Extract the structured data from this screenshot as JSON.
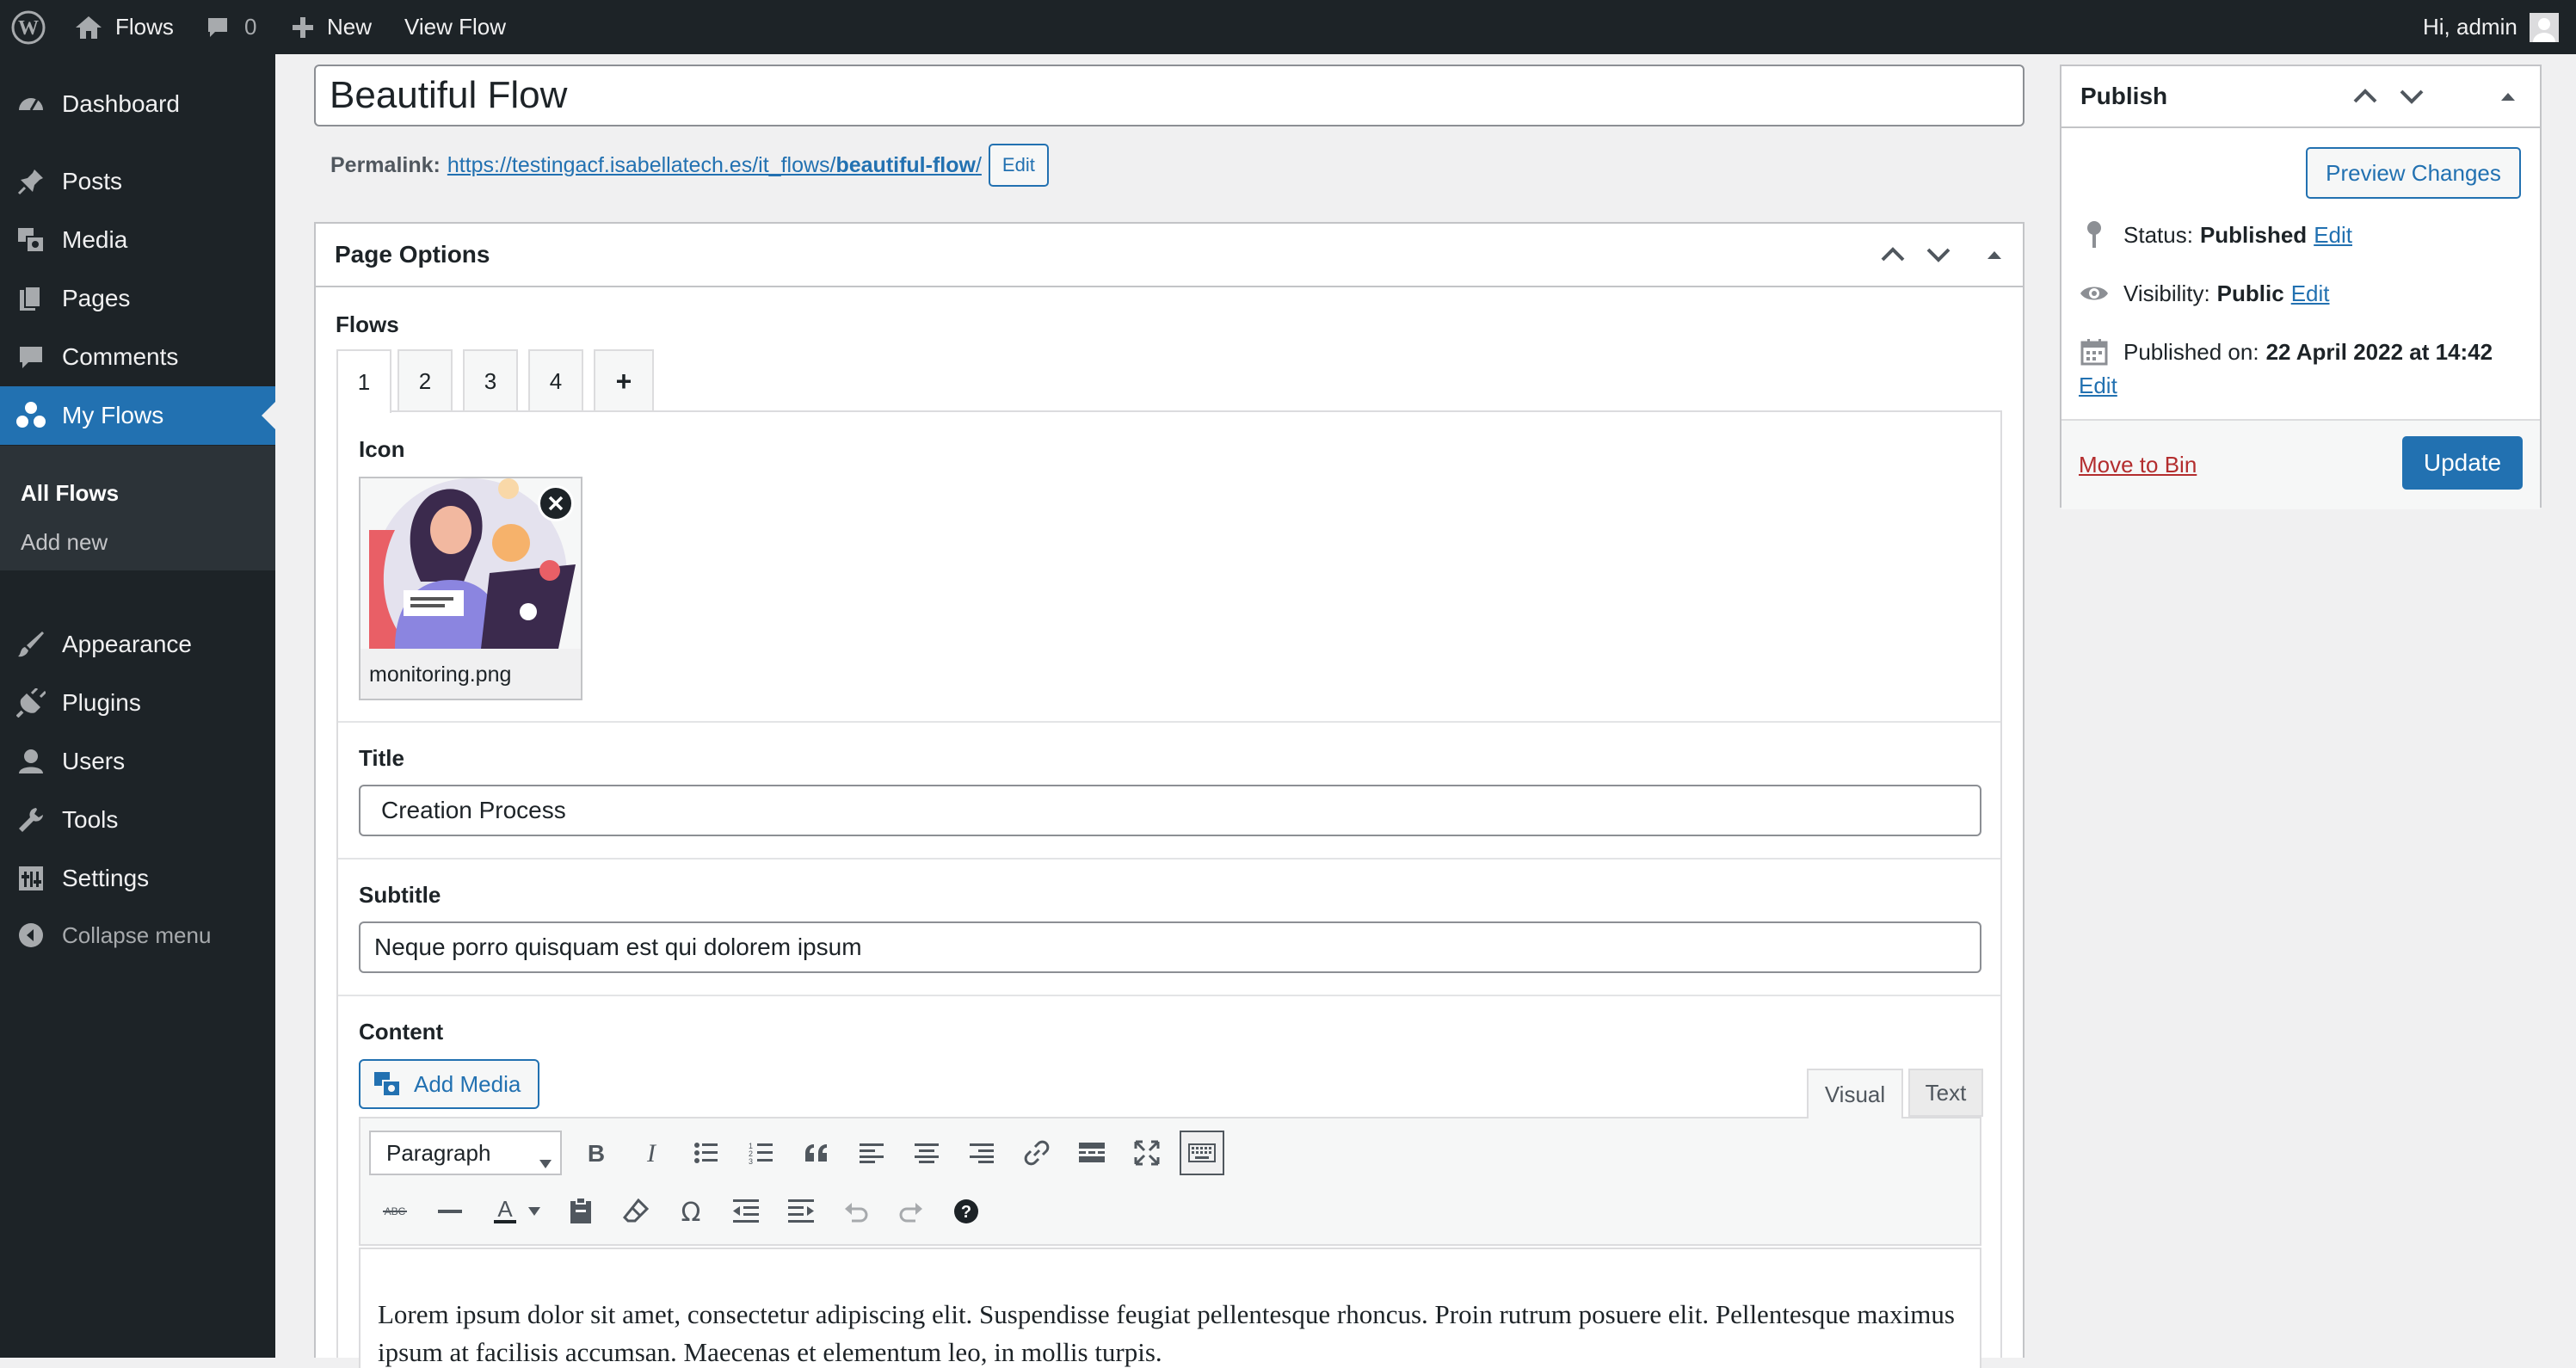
{
  "admin_bar": {
    "site_name": "Flows",
    "comments_count": "0",
    "new_label": "New",
    "view_label": "View Flow",
    "greeting": "Hi, admin"
  },
  "sidebar": {
    "items": [
      {
        "label": "Dashboard",
        "icon": "dashboard-icon"
      },
      {
        "label": "Posts",
        "icon": "pin-icon"
      },
      {
        "label": "Media",
        "icon": "media-icon"
      },
      {
        "label": "Pages",
        "icon": "pages-icon"
      },
      {
        "label": "Comments",
        "icon": "comment-icon"
      },
      {
        "label": "My Flows",
        "icon": "groups-icon"
      },
      {
        "label": "Appearance",
        "icon": "brush-icon"
      },
      {
        "label": "Plugins",
        "icon": "plug-icon"
      },
      {
        "label": "Users",
        "icon": "user-icon"
      },
      {
        "label": "Tools",
        "icon": "wrench-icon"
      },
      {
        "label": "Settings",
        "icon": "settings-icon"
      },
      {
        "label": "Collapse menu",
        "icon": "collapse-icon"
      }
    ],
    "submenu": [
      {
        "label": "All Flows"
      },
      {
        "label": "Add new"
      }
    ]
  },
  "editor": {
    "post_title": "Beautiful Flow",
    "permalink_label": "Permalink:",
    "permalink_prefix": "https://testingacf.isabellatech.es/it_flows/",
    "permalink_slug": "beautiful-flow",
    "permalink_suffix": "/",
    "edit_label": "Edit"
  },
  "page_options": {
    "title": "Page Options",
    "flows_label": "Flows",
    "tabs": [
      "1",
      "2",
      "3",
      "4",
      "+"
    ],
    "icon_label": "Icon",
    "icon_filename": "monitoring.png",
    "title_label": "Title",
    "title_value": "Creation Process",
    "subtitle_label": "Subtitle",
    "subtitle_value": "Neque porro quisquam est qui dolorem ipsum",
    "content_label": "Content",
    "add_media_label": "Add Media",
    "visual_tab": "Visual",
    "text_tab": "Text",
    "format_select": "Paragraph",
    "content_text": "Lorem ipsum dolor sit amet, consectetur adipiscing elit. Suspendisse feugiat pellentesque rhoncus. Proin rutrum posuere elit. Pellentesque maximus ipsum at facilisis accumsan. Maecenas et elementum leo, in mollis turpis."
  },
  "publish": {
    "title": "Publish",
    "preview_label": "Preview Changes",
    "status_label": "Status:",
    "status_value": "Published",
    "visibility_label": "Visibility:",
    "visibility_value": "Public",
    "published_label": "Published on:",
    "published_value": "22 April 2022 at 14:42",
    "edit_label": "Edit",
    "trash_label": "Move to Bin",
    "update_label": "Update"
  },
  "colors": {
    "accent": "#2271b1",
    "admin_dark": "#1d2327",
    "trash_red": "#b32d2e"
  }
}
